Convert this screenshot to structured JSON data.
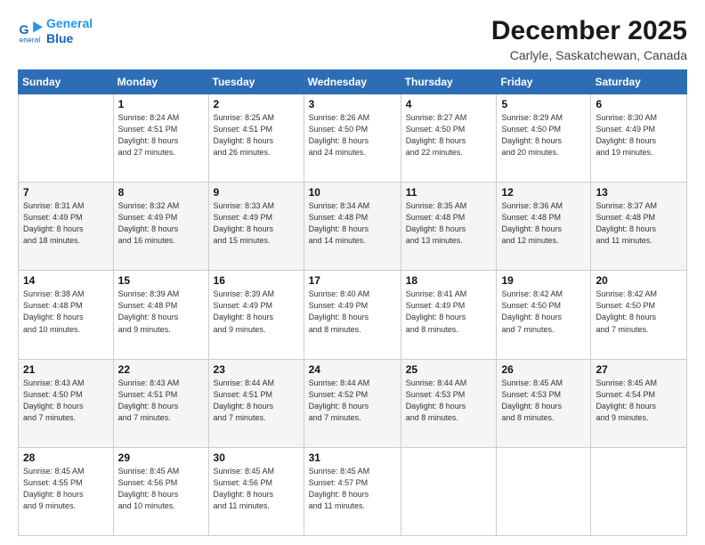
{
  "logo": {
    "line1": "General",
    "line2": "Blue"
  },
  "title": "December 2025",
  "location": "Carlyle, Saskatchewan, Canada",
  "weekdays": [
    "Sunday",
    "Monday",
    "Tuesday",
    "Wednesday",
    "Thursday",
    "Friday",
    "Saturday"
  ],
  "weeks": [
    [
      {
        "day": "",
        "info": ""
      },
      {
        "day": "1",
        "info": "Sunrise: 8:24 AM\nSunset: 4:51 PM\nDaylight: 8 hours\nand 27 minutes."
      },
      {
        "day": "2",
        "info": "Sunrise: 8:25 AM\nSunset: 4:51 PM\nDaylight: 8 hours\nand 26 minutes."
      },
      {
        "day": "3",
        "info": "Sunrise: 8:26 AM\nSunset: 4:50 PM\nDaylight: 8 hours\nand 24 minutes."
      },
      {
        "day": "4",
        "info": "Sunrise: 8:27 AM\nSunset: 4:50 PM\nDaylight: 8 hours\nand 22 minutes."
      },
      {
        "day": "5",
        "info": "Sunrise: 8:29 AM\nSunset: 4:50 PM\nDaylight: 8 hours\nand 20 minutes."
      },
      {
        "day": "6",
        "info": "Sunrise: 8:30 AM\nSunset: 4:49 PM\nDaylight: 8 hours\nand 19 minutes."
      }
    ],
    [
      {
        "day": "7",
        "info": "Sunrise: 8:31 AM\nSunset: 4:49 PM\nDaylight: 8 hours\nand 18 minutes."
      },
      {
        "day": "8",
        "info": "Sunrise: 8:32 AM\nSunset: 4:49 PM\nDaylight: 8 hours\nand 16 minutes."
      },
      {
        "day": "9",
        "info": "Sunrise: 8:33 AM\nSunset: 4:49 PM\nDaylight: 8 hours\nand 15 minutes."
      },
      {
        "day": "10",
        "info": "Sunrise: 8:34 AM\nSunset: 4:48 PM\nDaylight: 8 hours\nand 14 minutes."
      },
      {
        "day": "11",
        "info": "Sunrise: 8:35 AM\nSunset: 4:48 PM\nDaylight: 8 hours\nand 13 minutes."
      },
      {
        "day": "12",
        "info": "Sunrise: 8:36 AM\nSunset: 4:48 PM\nDaylight: 8 hours\nand 12 minutes."
      },
      {
        "day": "13",
        "info": "Sunrise: 8:37 AM\nSunset: 4:48 PM\nDaylight: 8 hours\nand 11 minutes."
      }
    ],
    [
      {
        "day": "14",
        "info": "Sunrise: 8:38 AM\nSunset: 4:48 PM\nDaylight: 8 hours\nand 10 minutes."
      },
      {
        "day": "15",
        "info": "Sunrise: 8:39 AM\nSunset: 4:48 PM\nDaylight: 8 hours\nand 9 minutes."
      },
      {
        "day": "16",
        "info": "Sunrise: 8:39 AM\nSunset: 4:49 PM\nDaylight: 8 hours\nand 9 minutes."
      },
      {
        "day": "17",
        "info": "Sunrise: 8:40 AM\nSunset: 4:49 PM\nDaylight: 8 hours\nand 8 minutes."
      },
      {
        "day": "18",
        "info": "Sunrise: 8:41 AM\nSunset: 4:49 PM\nDaylight: 8 hours\nand 8 minutes."
      },
      {
        "day": "19",
        "info": "Sunrise: 8:42 AM\nSunset: 4:50 PM\nDaylight: 8 hours\nand 7 minutes."
      },
      {
        "day": "20",
        "info": "Sunrise: 8:42 AM\nSunset: 4:50 PM\nDaylight: 8 hours\nand 7 minutes."
      }
    ],
    [
      {
        "day": "21",
        "info": "Sunrise: 8:43 AM\nSunset: 4:50 PM\nDaylight: 8 hours\nand 7 minutes."
      },
      {
        "day": "22",
        "info": "Sunrise: 8:43 AM\nSunset: 4:51 PM\nDaylight: 8 hours\nand 7 minutes."
      },
      {
        "day": "23",
        "info": "Sunrise: 8:44 AM\nSunset: 4:51 PM\nDaylight: 8 hours\nand 7 minutes."
      },
      {
        "day": "24",
        "info": "Sunrise: 8:44 AM\nSunset: 4:52 PM\nDaylight: 8 hours\nand 7 minutes."
      },
      {
        "day": "25",
        "info": "Sunrise: 8:44 AM\nSunset: 4:53 PM\nDaylight: 8 hours\nand 8 minutes."
      },
      {
        "day": "26",
        "info": "Sunrise: 8:45 AM\nSunset: 4:53 PM\nDaylight: 8 hours\nand 8 minutes."
      },
      {
        "day": "27",
        "info": "Sunrise: 8:45 AM\nSunset: 4:54 PM\nDaylight: 8 hours\nand 9 minutes."
      }
    ],
    [
      {
        "day": "28",
        "info": "Sunrise: 8:45 AM\nSunset: 4:55 PM\nDaylight: 8 hours\nand 9 minutes."
      },
      {
        "day": "29",
        "info": "Sunrise: 8:45 AM\nSunset: 4:56 PM\nDaylight: 8 hours\nand 10 minutes."
      },
      {
        "day": "30",
        "info": "Sunrise: 8:45 AM\nSunset: 4:56 PM\nDaylight: 8 hours\nand 11 minutes."
      },
      {
        "day": "31",
        "info": "Sunrise: 8:45 AM\nSunset: 4:57 PM\nDaylight: 8 hours\nand 11 minutes."
      },
      {
        "day": "",
        "info": ""
      },
      {
        "day": "",
        "info": ""
      },
      {
        "day": "",
        "info": ""
      }
    ]
  ]
}
